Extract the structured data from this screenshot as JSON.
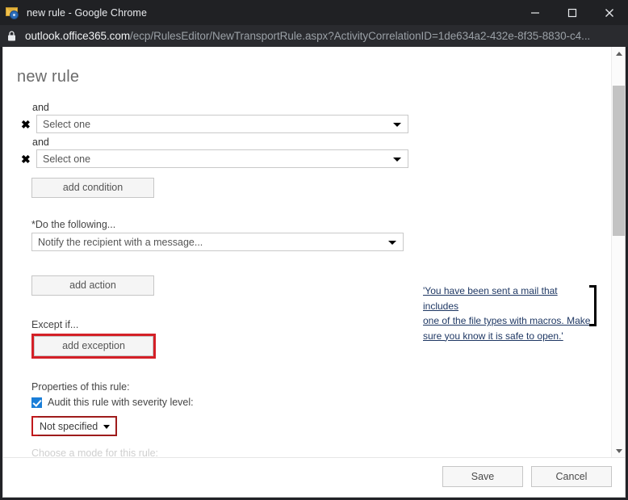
{
  "window": {
    "title": "new rule - Google Chrome",
    "favicon_icon": "mail-gear-icon",
    "minimize_icon": "minimize-icon",
    "maximize_icon": "maximize-icon",
    "close_icon": "close-icon"
  },
  "urlbar": {
    "lock_icon": "lock-icon",
    "domain": "outlook.office365.com",
    "path": "/ecp/RulesEditor/NewTransportRule.aspx?ActivityCorrelationID=1de634a2-432e-8f35-8830-c4..."
  },
  "page": {
    "title": "new rule",
    "conditions": [
      {
        "conjunction": "and",
        "remove_icon": "remove-x-icon",
        "value": "Select one"
      },
      {
        "conjunction": "and",
        "remove_icon": "remove-x-icon",
        "value": "Select one"
      }
    ],
    "add_condition_label": "add condition",
    "do_following_label": "*Do the following...",
    "action_value": "Notify the recipient with a message...",
    "add_action_label": "add action",
    "except_if_label": "Except if...",
    "add_exception_label": "add exception",
    "properties_label": "Properties of this rule:",
    "audit_label": "Audit this rule with severity level:",
    "severity_value": "Not specified",
    "clipped_label": "Choose a mode for this rule:",
    "caret_icon": "chevron-down-icon"
  },
  "note": {
    "line1": "'You have been sent a mail that includes",
    "line2": "one of the file types with macros. Make",
    "line3": "sure you know it is safe to open.'"
  },
  "scrollbar": {
    "up_icon": "scroll-up-arrow-icon",
    "down_icon": "scroll-down-arrow-icon"
  },
  "footer": {
    "save_label": "Save",
    "cancel_label": "Cancel"
  },
  "colors": {
    "annotation_red": "#d42027",
    "annotation_dark_red": "#9e1b1b",
    "accent_blue": "#1a7ed8",
    "note_text": "#1f3864"
  }
}
